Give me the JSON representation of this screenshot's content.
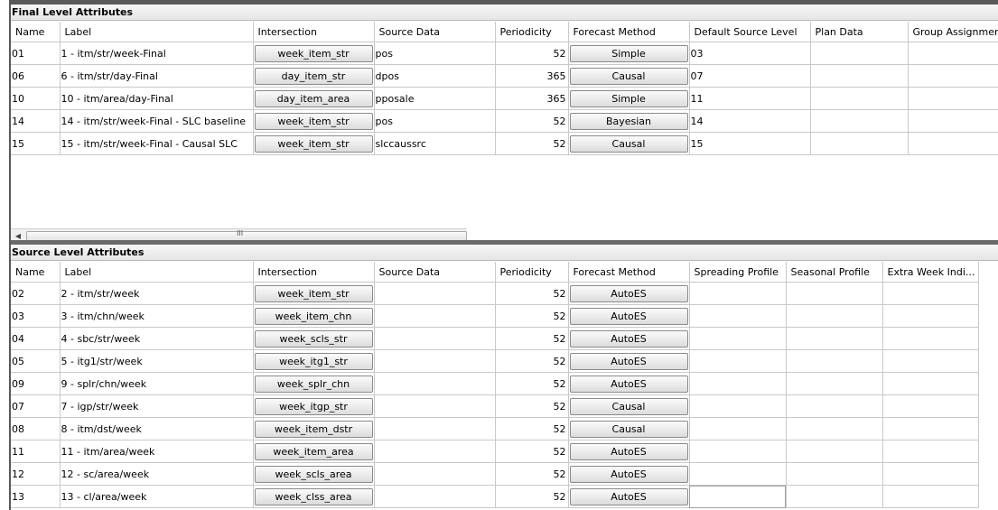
{
  "final_level": {
    "title": "Final Level Attributes",
    "columns": [
      "Name",
      "Label",
      "Intersection",
      "Source Data",
      "Periodicity",
      "Forecast Method",
      "Default Source Level",
      "Plan Data",
      "Group Assignment I"
    ],
    "rows": [
      {
        "name": "01",
        "label": "1 - itm/str/week-Final",
        "intersection": "week_item_str",
        "source_data": "pos",
        "periodicity": "52",
        "method": "Simple",
        "default_source": "03",
        "plan_data": "",
        "group": ""
      },
      {
        "name": "06",
        "label": "6 - itm/str/day-Final",
        "intersection": "day_item_str",
        "source_data": "dpos",
        "periodicity": "365",
        "method": "Causal",
        "default_source": "07",
        "plan_data": "",
        "group": ""
      },
      {
        "name": "10",
        "label": "10 - itm/area/day-Final",
        "intersection": "day_item_area",
        "source_data": "pposale",
        "periodicity": "365",
        "method": "Simple",
        "default_source": "11",
        "plan_data": "",
        "group": ""
      },
      {
        "name": "14",
        "label": "14 - itm/str/week-Final - SLC baseline",
        "intersection": "week_item_str",
        "source_data": "pos",
        "periodicity": "52",
        "method": "Bayesian",
        "default_source": "14",
        "plan_data": "",
        "group": ""
      },
      {
        "name": "15",
        "label": "15 - itm/str/week-Final - Causal SLC",
        "intersection": "week_item_str",
        "source_data": "slccaussrc",
        "periodicity": "52",
        "method": "Causal",
        "default_source": "15",
        "plan_data": "",
        "group": ""
      }
    ],
    "scrollbar_grip": "III",
    "scroll_left_icon": "arrow-left"
  },
  "source_level": {
    "title": "Source Level Attributes",
    "columns": [
      "Name",
      "Label",
      "Intersection",
      "Source Data",
      "Periodicity",
      "Forecast Method",
      "Spreading Profile",
      "Seasonal Profile",
      "Extra Week Indi..."
    ],
    "rows": [
      {
        "name": "02",
        "label": "2 - itm/str/week",
        "intersection": "week_item_str",
        "source_data": "",
        "periodicity": "52",
        "method": "AutoES"
      },
      {
        "name": "03",
        "label": "3 - itm/chn/week",
        "intersection": "week_item_chn",
        "source_data": "",
        "periodicity": "52",
        "method": "AutoES"
      },
      {
        "name": "04",
        "label": "4 - sbc/str/week",
        "intersection": "week_scls_str",
        "source_data": "",
        "periodicity": "52",
        "method": "AutoES"
      },
      {
        "name": "05",
        "label": "5 - itg1/str/week",
        "intersection": "week_itg1_str",
        "source_data": "",
        "periodicity": "52",
        "method": "AutoES"
      },
      {
        "name": "09",
        "label": "9 - splr/chn/week",
        "intersection": "week_splr_chn",
        "source_data": "",
        "periodicity": "52",
        "method": "AutoES"
      },
      {
        "name": "07",
        "label": "7 - igp/str/week",
        "intersection": "week_itgp_str",
        "source_data": "",
        "periodicity": "52",
        "method": "Causal"
      },
      {
        "name": "08",
        "label": "8 - itm/dst/week",
        "intersection": "week_item_dstr",
        "source_data": "",
        "periodicity": "52",
        "method": "Causal"
      },
      {
        "name": "11",
        "label": "11 - itm/area/week",
        "intersection": "week_item_area",
        "source_data": "",
        "periodicity": "52",
        "method": "AutoES"
      },
      {
        "name": "12",
        "label": "12 - sc/area/week",
        "intersection": "week_scls_area",
        "source_data": "",
        "periodicity": "52",
        "method": "AutoES"
      },
      {
        "name": "13",
        "label": "13 - cl/area/week",
        "intersection": "week_clss_area",
        "source_data": "",
        "periodicity": "52",
        "method": "AutoES"
      }
    ]
  }
}
